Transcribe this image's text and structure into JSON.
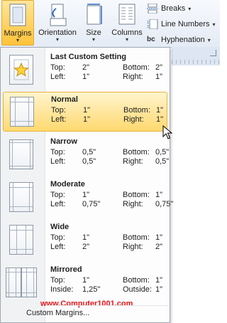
{
  "ribbon": {
    "margins_label": "Margins",
    "orientation_label": "Orientation",
    "size_label": "Size",
    "columns_label": "Columns",
    "breaks_label": "Breaks",
    "line_numbers_label": "Line Numbers",
    "hyphenation_label": "Hyphenation",
    "hyphenation_icon_text": "bc",
    "caret": "▾"
  },
  "menu": {
    "items": [
      {
        "title": "Last Custom Setting",
        "r1a": "Top:",
        "r1b": "2\"",
        "r1c": "Bottom:",
        "r1d": "2\"",
        "r2a": "Left:",
        "r2b": "1\"",
        "r2c": "Right:",
        "r2d": "1\""
      },
      {
        "title": "Normal",
        "r1a": "Top:",
        "r1b": "1\"",
        "r1c": "Bottom:",
        "r1d": "1\"",
        "r2a": "Left:",
        "r2b": "1\"",
        "r2c": "Right:",
        "r2d": "1\""
      },
      {
        "title": "Narrow",
        "r1a": "Top:",
        "r1b": "0,5\"",
        "r1c": "Bottom:",
        "r1d": "0,5\"",
        "r2a": "Left:",
        "r2b": "0,5\"",
        "r2c": "Right:",
        "r2d": "0,5\""
      },
      {
        "title": "Moderate",
        "r1a": "Top:",
        "r1b": "1\"",
        "r1c": "Bottom:",
        "r1d": "1\"",
        "r2a": "Left:",
        "r2b": "0,75\"",
        "r2c": "Right:",
        "r2d": "0,75\""
      },
      {
        "title": "Wide",
        "r1a": "Top:",
        "r1b": "1\"",
        "r1c": "Bottom:",
        "r1d": "1\"",
        "r2a": "Left:",
        "r2b": "2\"",
        "r2c": "Right:",
        "r2d": "2\""
      },
      {
        "title": "Mirrored",
        "r1a": "Top:",
        "r1b": "1\"",
        "r1c": "Bottom:",
        "r1d": "1\"",
        "r2a": "Inside:",
        "r2b": "1,25\"",
        "r2c": "Outside:",
        "r2d": "1\""
      }
    ],
    "custom_margins_label": "Custom Margins...",
    "watermark": "www.Computer1001.com"
  },
  "colors": {
    "highlight": "#ffe59a",
    "watermark": "#e8141a"
  }
}
